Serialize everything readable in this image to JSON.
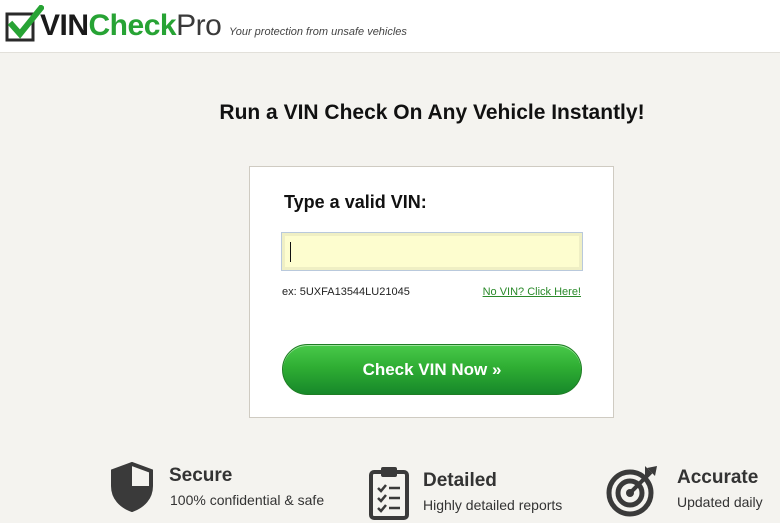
{
  "header": {
    "logo": {
      "vin": "VIN",
      "check": "Check",
      "pro": "Pro"
    },
    "tagline": "Your protection from unsafe vehicles"
  },
  "main": {
    "headline": "Run a VIN Check On Any Vehicle Instantly!",
    "form": {
      "label": "Type a valid VIN:",
      "input_value": "",
      "example": "ex: 5UXFA13544LU21045",
      "no_vin_link": "No VIN? Click Here!",
      "submit_label": "Check VIN Now »"
    }
  },
  "features": [
    {
      "icon": "shield-icon",
      "title": "Secure",
      "description": "100% confidential & safe"
    },
    {
      "icon": "clipboard-checklist-icon",
      "title": "Detailed",
      "description": "Highly detailed reports"
    },
    {
      "icon": "target-icon",
      "title": "Accurate",
      "description": "Updated daily"
    }
  ],
  "colors": {
    "brand_green": "#27a334",
    "button_green": "#2fae33",
    "input_bg": "#fdfdcf",
    "page_bg": "#f4f3ef",
    "icon_gray": "#3a3a3a"
  }
}
